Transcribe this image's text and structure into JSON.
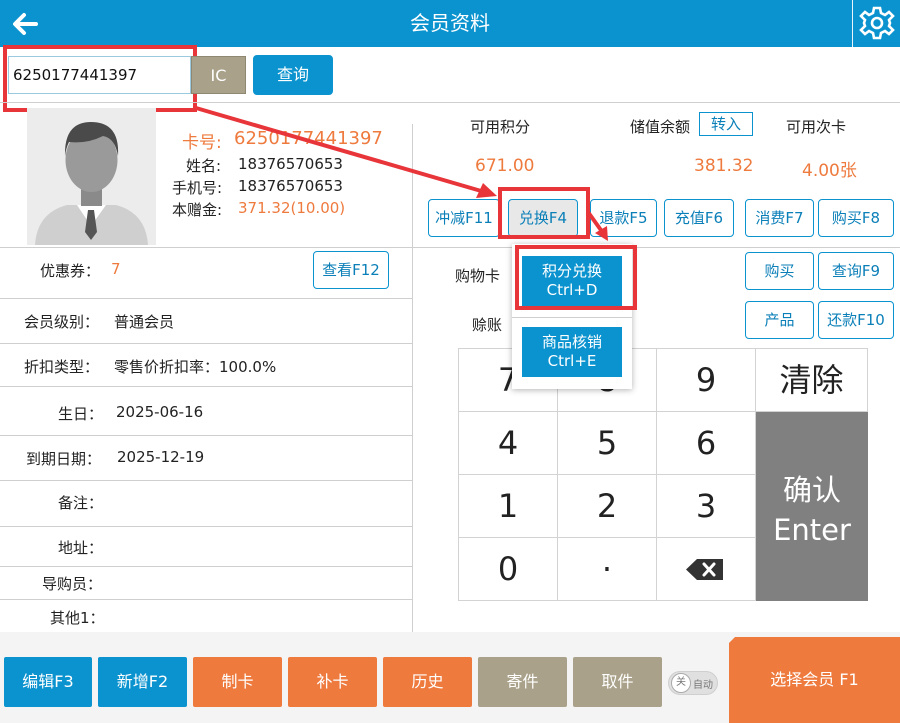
{
  "header": {
    "title": "会员资料",
    "back_icon": "arrow-left-icon",
    "settings_icon": "gear-icon"
  },
  "search": {
    "card_value": "6250177441397",
    "ic_label": "IC",
    "query_label": "查询"
  },
  "member": {
    "card_label": "卡号:",
    "card_no": "6250177441397",
    "name_label": "姓名:",
    "name": "18376570653",
    "phone_label": "手机号:",
    "phone": "18376570653",
    "gift_label": "本赠金:",
    "gift": "371.32(10.00)"
  },
  "balances": {
    "points_label": "可用积分",
    "points": "671.00",
    "stored_label": "储值余额",
    "transfer_label": "转入",
    "stored": "381.32",
    "times_label": "可用次卡",
    "times": "4.00张"
  },
  "actions": {
    "offset": "冲减F11",
    "exchange": "兑换F4",
    "refund": "退款F5",
    "recharge": "充值F6",
    "consume": "消费F7",
    "purchase": "购买F8"
  },
  "dropdown": {
    "item1_line1": "积分兑换",
    "item1_line2": "Ctrl+D",
    "item2_line1": "商品核销",
    "item2_line2": "Ctrl+E"
  },
  "cart": {
    "label": "购物卡",
    "buy": "购买",
    "query": "查询F9"
  },
  "credit": {
    "label": "赊账",
    "product": "产品",
    "repay": "还款F10"
  },
  "details": {
    "coupon_label": "优惠券：",
    "coupon_value": "7",
    "view_label": "查看F12",
    "level_label": "会员级别：",
    "level_value": "普通会员",
    "discount_label": "折扣类型：",
    "discount_value": "零售价折扣率：100.0%",
    "birthday_label": "生日：",
    "birthday_value": "2025-06-16",
    "expire_label": "到期日期：",
    "expire_value": "2025-12-19",
    "note_label": "备注：",
    "address_label": "地址：",
    "guide_label": "导购员：",
    "other_label": "其他1："
  },
  "keypad": {
    "k7": "7",
    "k8": "8",
    "k9": "9",
    "clear": "清除",
    "k4": "4",
    "k5": "5",
    "k6": "6",
    "confirm_line1": "确认",
    "confirm_line2": "Enter",
    "k1": "1",
    "k2": "2",
    "k3": "3",
    "k0": "0",
    "dot": "·"
  },
  "bottom": {
    "edit": "编辑F3",
    "add": "新增F2",
    "make_card": "制卡",
    "reissue": "补卡",
    "history": "历史",
    "deposit": "寄件",
    "pickup": "取件",
    "auto_toggle_off": "关",
    "auto_toggle_label": "自动",
    "select_member": "选择会员 F1"
  },
  "colors": {
    "primary": "#0b93cf",
    "orange": "#ee7a3e",
    "grey": "#a9a189",
    "highlight": "#e8353a"
  }
}
